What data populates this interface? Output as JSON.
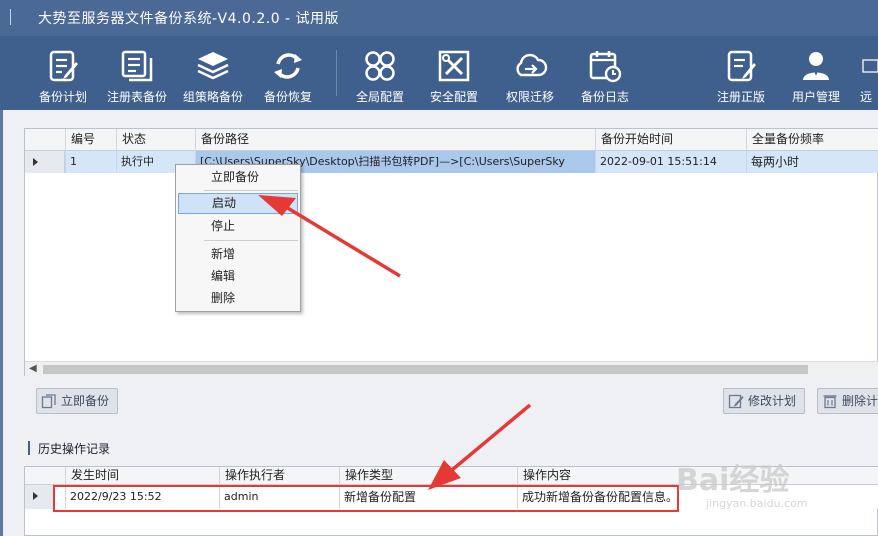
{
  "window": {
    "title": "大势至服务器文件备份系统-V4.0.2.0 - 试用版"
  },
  "toolbar": {
    "items": [
      {
        "label": "备份计划",
        "icon": "edit-list-icon"
      },
      {
        "label": "注册表备份",
        "icon": "documents-icon"
      },
      {
        "label": "组策略备份",
        "icon": "layers-icon"
      },
      {
        "label": "备份恢复",
        "icon": "refresh-icon"
      },
      {
        "label": "全局配置",
        "icon": "grid-icon"
      },
      {
        "label": "安全配置",
        "icon": "tools-icon"
      },
      {
        "label": "权限迁移",
        "icon": "cloud-transfer-icon"
      },
      {
        "label": "备份日志",
        "icon": "calendar-clock-icon"
      },
      {
        "label": "注册正版",
        "icon": "register-icon"
      },
      {
        "label": "用户管理",
        "icon": "users-icon"
      },
      {
        "label": "远",
        "icon": "remote-icon"
      }
    ]
  },
  "plan_table": {
    "columns": [
      "编号",
      "状态",
      "备份路径",
      "备份开始时间",
      "全量备份频率"
    ],
    "rows": [
      {
        "id": "1",
        "status": "执行中",
        "path": "[C:\\Users\\SuperSky\\Desktop\\扫描书包转PDF]—>[C:\\Users\\SuperSky",
        "start_time": "2022-09-01 15:51:14",
        "frequency": "每两小时"
      }
    ]
  },
  "context_menu": {
    "items": [
      "立即备份",
      "启动",
      "停止",
      "新增",
      "编辑",
      "删除"
    ],
    "highlighted": "启动"
  },
  "actions": {
    "backup_now": "立即备份",
    "edit_plan": "修改计划",
    "delete_plan": "删除计"
  },
  "history": {
    "title": "历史操作记录",
    "columns": [
      "发生时间",
      "操作执行者",
      "操作类型",
      "操作内容"
    ],
    "rows": [
      {
        "time": "2022/9/23 15:52",
        "user": "admin",
        "type": "新增备份配置",
        "content": "成功新增备份备份配置信息。"
      }
    ]
  },
  "watermark": {
    "brand": "Bai经验",
    "url": "jingyan.baidu.com"
  },
  "colors": {
    "accent": "#3f5f8c",
    "annotation": "#e53935",
    "selection": "#d5e6f8"
  }
}
